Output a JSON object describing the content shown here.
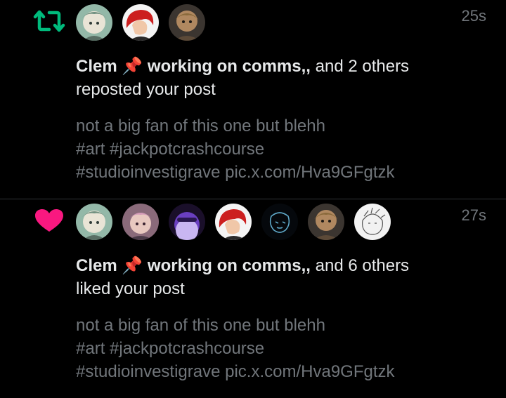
{
  "notifications": [
    {
      "type": "repost",
      "icon": "repost-icon",
      "icon_color": "#00ba7c",
      "time": "25s",
      "actor_name": "Clem",
      "actor_badge": "📌",
      "actor_status": "working on comms,,",
      "others": "and 2 others",
      "action": "reposted your post",
      "post_lines": [
        "not a big fan of this one but blehh",
        "#art #jackpotcrashcourse",
        "#studioinvestigrave pic.x.com/Hva9GFgtzk"
      ],
      "avatar_count": 3
    },
    {
      "type": "like",
      "icon": "heart-icon",
      "icon_color": "#f91880",
      "time": "27s",
      "actor_name": "Clem",
      "actor_badge": "📌",
      "actor_status": "working on comms,,",
      "others": "and 6 others",
      "action": "liked your post",
      "post_lines": [
        "not a big fan of this one but blehh",
        "#art #jackpotcrashcourse",
        "#studioinvestigrave pic.x.com/Hva9GFgtzk"
      ],
      "avatar_count": 7
    }
  ],
  "colors": {
    "background": "#000000",
    "text_primary": "#e7e9ea",
    "text_secondary": "#71767b",
    "divider": "#2f3336"
  }
}
